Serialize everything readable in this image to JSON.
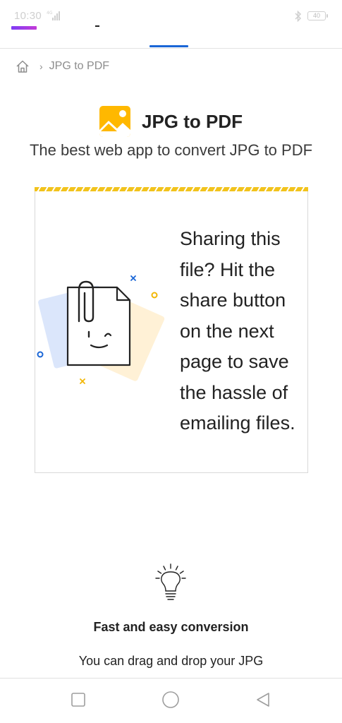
{
  "status_bar": {
    "time": "10:30",
    "battery": "40"
  },
  "breadcrumb": {
    "separator": "›",
    "current": "JPG to PDF"
  },
  "header": {
    "title": "JPG to PDF",
    "subtitle": "The best web app to convert JPG to PDF"
  },
  "tip": {
    "text": "Sharing this file? Hit the share button on the next page to save the hassle of emailing files."
  },
  "feature": {
    "title": "Fast and easy conversion",
    "description": "You can drag and drop your JPG"
  },
  "colors": {
    "accent_blue": "#1a66d6",
    "brand_yellow": "#ffb800"
  },
  "icons": [
    "home-icon",
    "image-icon",
    "paperclip-file-icon",
    "lightbulb-icon",
    "recent-apps-icon",
    "home-nav-icon",
    "back-icon"
  ]
}
